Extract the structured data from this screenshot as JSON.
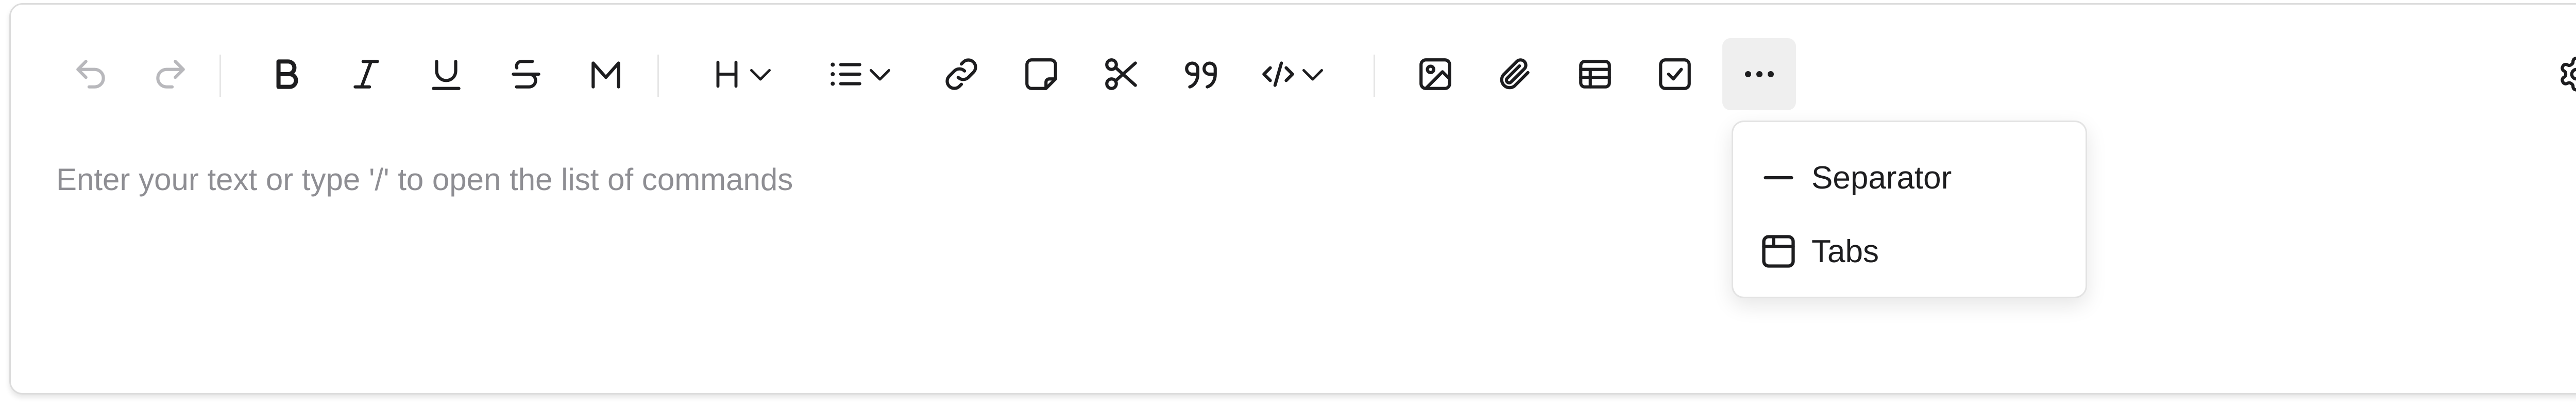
{
  "editor": {
    "placeholder": "Enter your text or type '/' to open the list of commands"
  },
  "toolbar": {
    "buttons": [
      {
        "name": "undo",
        "icon": "undo-icon",
        "enabled": false
      },
      {
        "name": "redo",
        "icon": "redo-icon",
        "enabled": false
      },
      {
        "name": "bold",
        "icon": "bold-icon",
        "enabled": true
      },
      {
        "name": "italic",
        "icon": "italic-icon",
        "enabled": true
      },
      {
        "name": "underline",
        "icon": "underline-icon",
        "enabled": true
      },
      {
        "name": "strikethrough",
        "icon": "strikethrough-icon",
        "enabled": true
      },
      {
        "name": "marker",
        "icon": "marker-icon",
        "enabled": true
      },
      {
        "name": "heading",
        "icon": "heading-icon",
        "dropdown": true
      },
      {
        "name": "list",
        "icon": "list-icon",
        "dropdown": true
      },
      {
        "name": "link",
        "icon": "link-icon"
      },
      {
        "name": "note",
        "icon": "sticky-note-icon"
      },
      {
        "name": "cut",
        "icon": "scissors-icon"
      },
      {
        "name": "quote",
        "icon": "quote-icon"
      },
      {
        "name": "code",
        "icon": "code-icon",
        "dropdown": true
      },
      {
        "name": "image",
        "icon": "image-icon"
      },
      {
        "name": "attachment",
        "icon": "paperclip-icon"
      },
      {
        "name": "table",
        "icon": "table-icon"
      },
      {
        "name": "checklist",
        "icon": "checkbox-icon"
      },
      {
        "name": "more",
        "icon": "more-dots-icon",
        "active": true
      }
    ],
    "settings_icon": "gear-icon"
  },
  "more_menu": {
    "items": [
      {
        "label": "Separator",
        "icon": "horizontal-rule-icon"
      },
      {
        "label": "Tabs",
        "icon": "tabs-icon"
      }
    ]
  },
  "colors": {
    "icon": "#1d1d1f",
    "icon_disabled": "#b8b8bc",
    "placeholder": "#8e8e93",
    "border": "#dcdcdc",
    "active_bg": "#efefef"
  }
}
